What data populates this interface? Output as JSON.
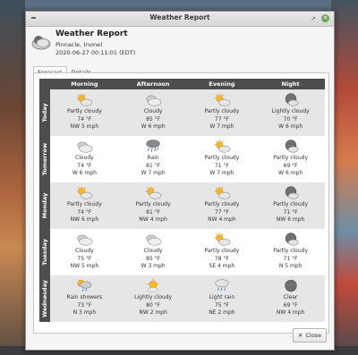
{
  "window": {
    "title": "Weather Report"
  },
  "header": {
    "title": "Weather Report",
    "location": "Pinnacle, (none)",
    "timestamp": "2020-06-27 00:11:01 (EDT)"
  },
  "tabs": [
    {
      "label": "Forecast",
      "active": true
    },
    {
      "label": "Details",
      "active": false
    }
  ],
  "periods": [
    "Morning",
    "Afternoon",
    "Evening",
    "Night"
  ],
  "days": [
    {
      "label": "Today",
      "cells": [
        {
          "icon": "sun-cloud-icon",
          "condition": "Partly cloudy",
          "temp": "74 °F",
          "wind": "NW 5 mph"
        },
        {
          "icon": "cloud-icon",
          "condition": "Cloudy",
          "temp": "85 °F",
          "wind": "W 6 mph"
        },
        {
          "icon": "sun-cloud-icon",
          "condition": "Partly cloudy",
          "temp": "77 °F",
          "wind": "W 7 mph"
        },
        {
          "icon": "moon-cloud-icon",
          "condition": "Lightly cloudy",
          "temp": "70 °F",
          "wind": "W 6 mph"
        }
      ]
    },
    {
      "label": "Tomorrow",
      "cells": [
        {
          "icon": "cloud-icon",
          "condition": "Cloudy",
          "temp": "74 °F",
          "wind": "W 6 mph"
        },
        {
          "icon": "rain-icon",
          "condition": "Rain",
          "temp": "81 °F",
          "wind": "W 7 mph"
        },
        {
          "icon": "sun-cloud-icon",
          "condition": "Partly cloudy",
          "temp": "71 °F",
          "wind": "W 7 mph"
        },
        {
          "icon": "moon-cloud-icon",
          "condition": "Partly cloudy",
          "temp": "69 °F",
          "wind": "W 6 mph"
        }
      ]
    },
    {
      "label": "Monday",
      "cells": [
        {
          "icon": "sun-cloud-icon",
          "condition": "Partly cloudy",
          "temp": "74 °F",
          "wind": "NW 6 mph"
        },
        {
          "icon": "sun-cloud-icon",
          "condition": "Partly cloudy",
          "temp": "81 °F",
          "wind": "NW 4 mph"
        },
        {
          "icon": "sun-cloud-icon",
          "condition": "Partly cloudy",
          "temp": "77 °F",
          "wind": "NW 4 mph"
        },
        {
          "icon": "moon-cloud-icon",
          "condition": "Partly cloudy",
          "temp": "71 °F",
          "wind": "NW 6 mph"
        }
      ]
    },
    {
      "label": "Tuesday",
      "cells": [
        {
          "icon": "cloud-icon",
          "condition": "Cloudy",
          "temp": "75 °F",
          "wind": "NW 5 mph"
        },
        {
          "icon": "cloud-icon",
          "condition": "Cloudy",
          "temp": "85 °F",
          "wind": "W 3 mph"
        },
        {
          "icon": "sun-cloud-icon",
          "condition": "Partly cloudy",
          "temp": "78 °F",
          "wind": "SE 4 mph"
        },
        {
          "icon": "moon-cloud-icon",
          "condition": "Partly cloudy",
          "temp": "71 °F",
          "wind": "N 5 mph"
        }
      ]
    },
    {
      "label": "Wednesday",
      "cells": [
        {
          "icon": "sun-rain-icon",
          "condition": "Rain showers",
          "temp": "73 °F",
          "wind": "N 3 mph"
        },
        {
          "icon": "sun-light-cloud-icon",
          "condition": "Lightly cloudy",
          "temp": "80 °F",
          "wind": "NW 2 mph"
        },
        {
          "icon": "light-rain-icon",
          "condition": "Light rain",
          "temp": "75 °F",
          "wind": "NE 2 mph"
        },
        {
          "icon": "moon-icon",
          "condition": "Clear",
          "temp": "69 °F",
          "wind": "NW 4 mph"
        }
      ]
    }
  ],
  "footer": {
    "close_label": "Close",
    "close_icon": "close-icon"
  }
}
